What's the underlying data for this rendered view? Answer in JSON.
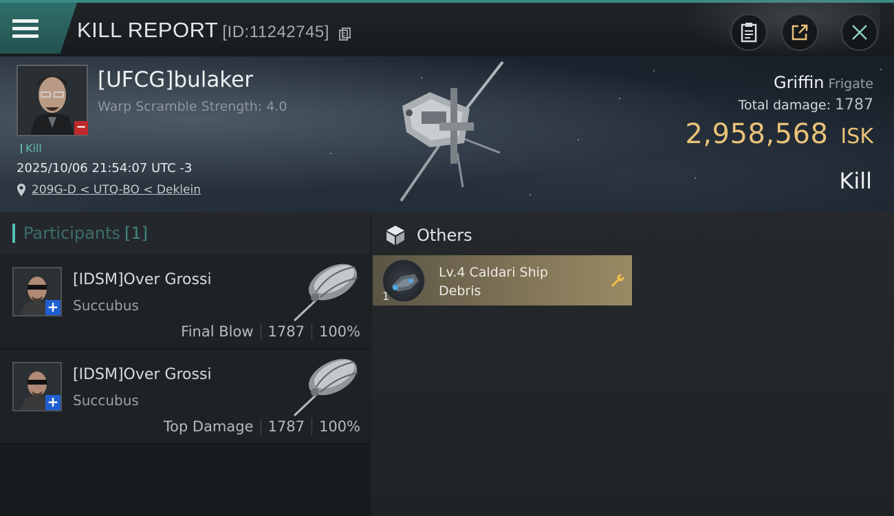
{
  "header": {
    "title": "KILL REPORT",
    "report_id": "[ID:11242745]"
  },
  "victim": {
    "name": "[UFCG]bulaker",
    "warp_scramble": "Warp Scramble Strength: 4.0",
    "tag": "Kill",
    "timestamp": "2025/10/06 21:54:07 UTC -3",
    "location": "209G-D < UTQ-BO < Deklein",
    "ship_name": "Griffin",
    "ship_class": "Frigate",
    "total_damage_label": "Total damage:",
    "total_damage_value": "1787",
    "isk_value": "2,958,568",
    "isk_unit": "ISK",
    "result": "Kill"
  },
  "participants": {
    "title": "Participants",
    "count": "[1]",
    "rows": [
      {
        "name": "[IDSM]Over Grossi",
        "ship": "Succubus",
        "role": "Final Blow",
        "damage": "1787",
        "percent": "100%"
      },
      {
        "name": "[IDSM]Over Grossi",
        "ship": "Succubus",
        "role": "Top Damage",
        "damage": "1787",
        "percent": "100%"
      }
    ]
  },
  "others": {
    "title": "Others",
    "items": [
      {
        "name": "Lv.4 Caldari Ship Debris",
        "quantity": "1"
      }
    ]
  },
  "colors": {
    "accent_teal": "#3c8a84",
    "isk_gold": "#e9c27a",
    "loss_red": "#c0282a",
    "friendly_blue": "#1f5fd0"
  },
  "icons": [
    "menu-icon",
    "copy-icon",
    "clipboard-icon",
    "share-icon",
    "close-icon",
    "location-pin-icon",
    "cube-icon",
    "wrench-icon"
  ]
}
